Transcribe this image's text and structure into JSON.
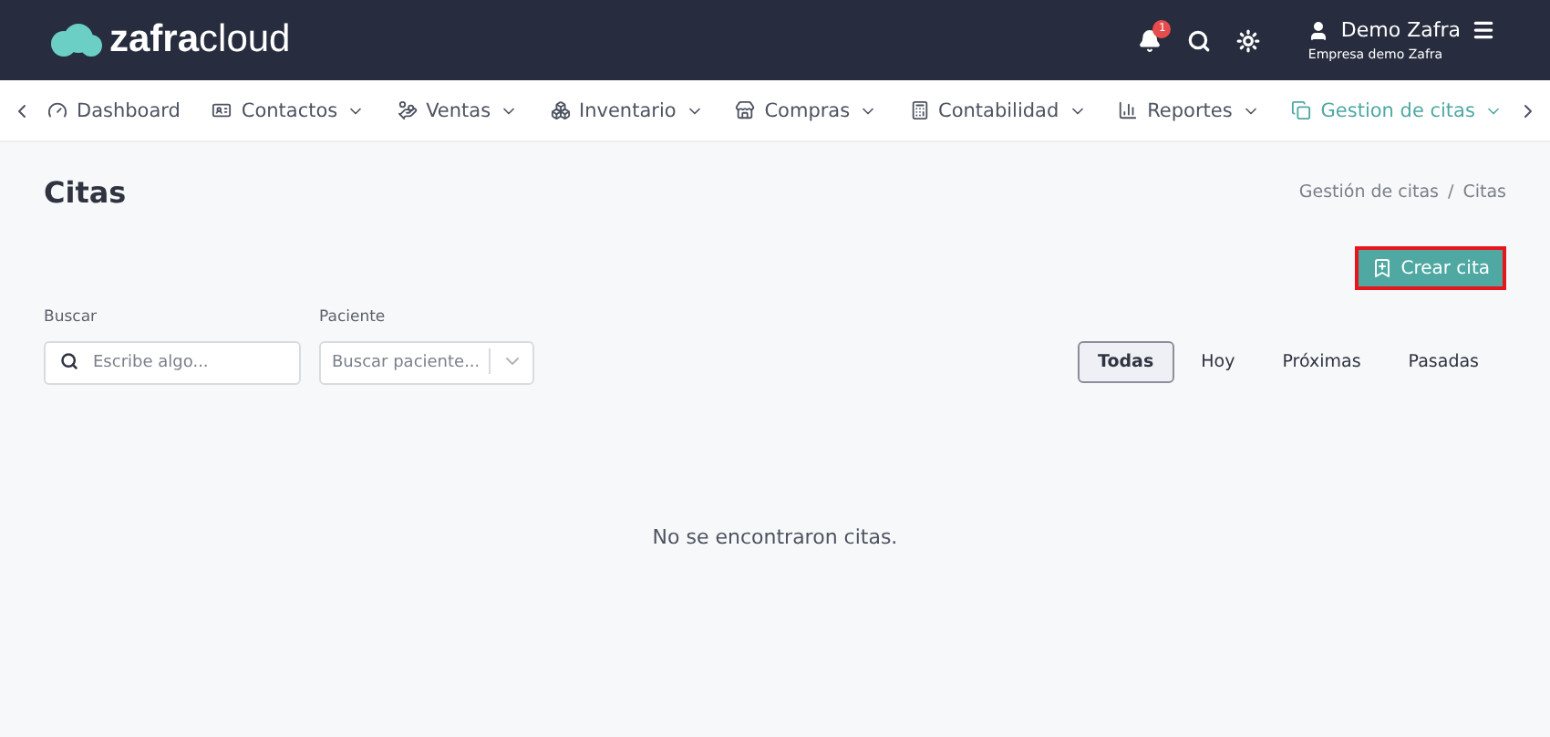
{
  "header": {
    "logo_bold": "zafra",
    "logo_light": "cloud",
    "notifications": "1",
    "user_name": "Demo Zafra",
    "company": "Empresa demo Zafra"
  },
  "nav": [
    {
      "label": "Dashboard",
      "dropdown": false,
      "selected": false
    },
    {
      "label": "Contactos",
      "dropdown": true,
      "selected": false
    },
    {
      "label": "Ventas",
      "dropdown": true,
      "selected": false
    },
    {
      "label": "Inventario",
      "dropdown": true,
      "selected": false
    },
    {
      "label": "Compras",
      "dropdown": true,
      "selected": false
    },
    {
      "label": "Contabilidad",
      "dropdown": true,
      "selected": false
    },
    {
      "label": "Reportes",
      "dropdown": true,
      "selected": false
    },
    {
      "label": "Gestion de citas",
      "dropdown": true,
      "selected": true
    }
  ],
  "page": {
    "title": "Citas",
    "breadcrumb": [
      "Gestión de citas",
      "Citas"
    ],
    "breadcrumb_separator": "/",
    "create_button": {
      "label": "Crear cita",
      "highlighted": true
    }
  },
  "filters": {
    "search": {
      "label": "Buscar",
      "placeholder": "Escribe algo..."
    },
    "patient": {
      "label": "Paciente",
      "placeholder": "Buscar paciente..."
    }
  },
  "tabs": [
    {
      "label": "Todas",
      "selected": true
    },
    {
      "label": "Hoy",
      "selected": false
    },
    {
      "label": "Próximas",
      "selected": false
    },
    {
      "label": "Pasadas",
      "selected": false
    }
  ],
  "empty_message": "No se encontraron citas."
}
